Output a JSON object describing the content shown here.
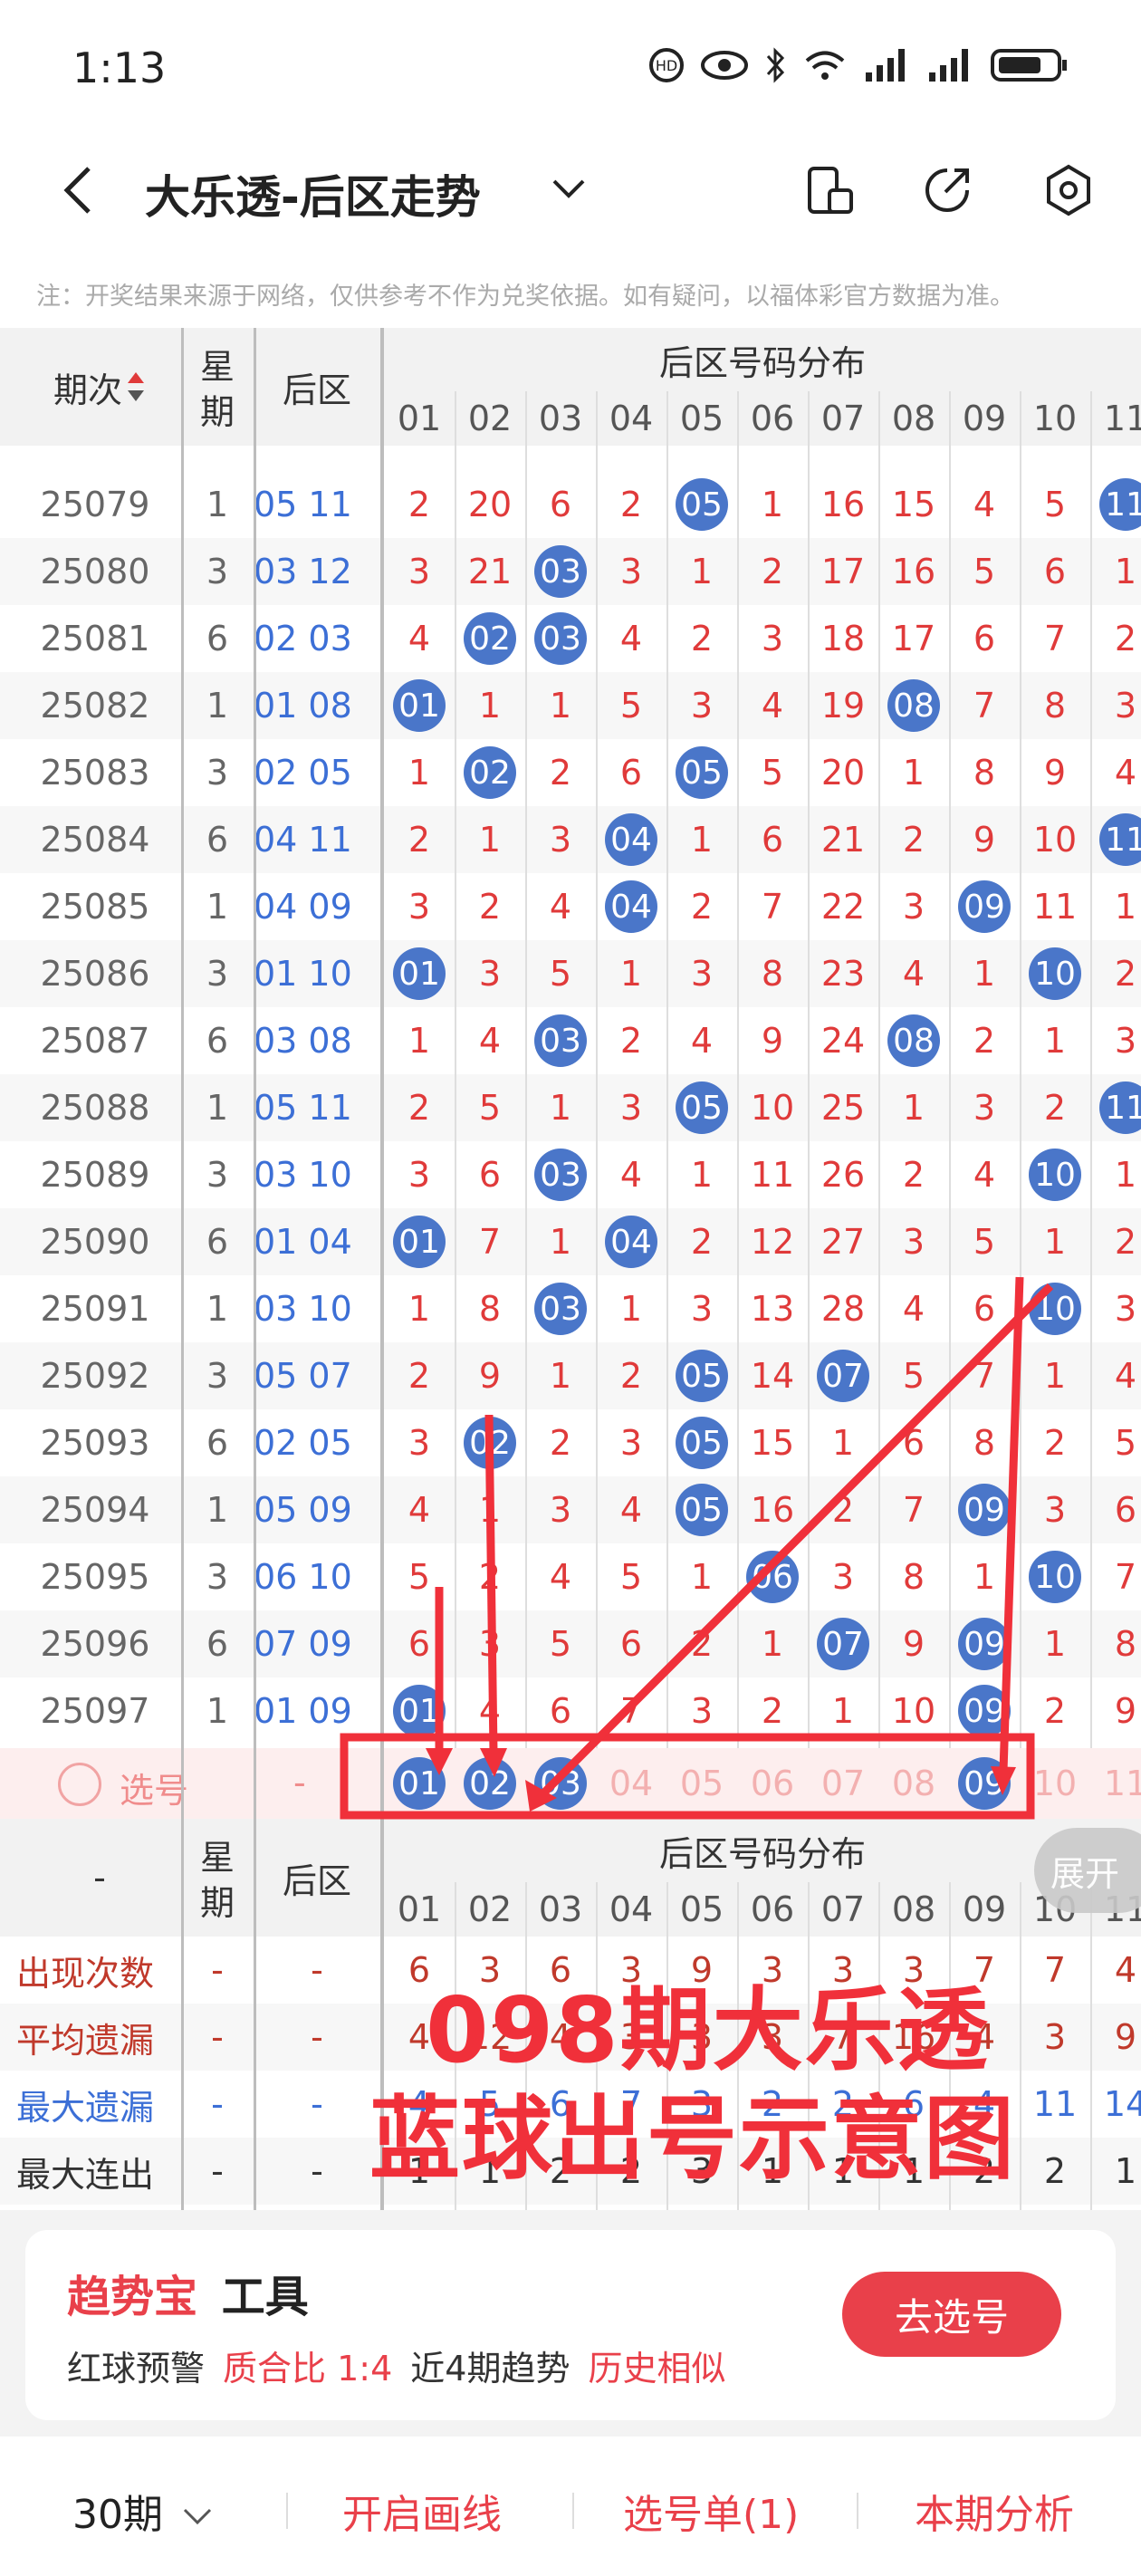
{
  "status": {
    "time": "1:13"
  },
  "header": {
    "title": "大乐透-后区走势"
  },
  "notice": "注：开奖结果来源于网络，仅供参考不作为兑奖依据。如有疑问，以福体彩官方数据为准。",
  "table_header": {
    "period": "期次",
    "weekday_line1": "星",
    "weekday_line2": "期",
    "back": "后区",
    "distribution": "后区号码分布",
    "numbers": [
      "01",
      "02",
      "03",
      "04",
      "05",
      "06",
      "07",
      "08",
      "09",
      "10",
      "11"
    ]
  },
  "rows": [
    {
      "period": "25079",
      "week": "1",
      "back": "05 11",
      "cells": [
        "2",
        "20",
        "6",
        "2",
        "05",
        "1",
        "16",
        "15",
        "4",
        "5",
        "11"
      ],
      "hits": [
        4,
        10
      ]
    },
    {
      "period": "25080",
      "week": "3",
      "back": "03 12",
      "cells": [
        "3",
        "21",
        "03",
        "3",
        "1",
        "2",
        "17",
        "16",
        "5",
        "6",
        "1"
      ],
      "hits": [
        2
      ]
    },
    {
      "period": "25081",
      "week": "6",
      "back": "02 03",
      "cells": [
        "4",
        "02",
        "03",
        "4",
        "2",
        "3",
        "18",
        "17",
        "6",
        "7",
        "2"
      ],
      "hits": [
        1,
        2
      ]
    },
    {
      "period": "25082",
      "week": "1",
      "back": "01 08",
      "cells": [
        "01",
        "1",
        "1",
        "5",
        "3",
        "4",
        "19",
        "08",
        "7",
        "8",
        "3"
      ],
      "hits": [
        0,
        7
      ]
    },
    {
      "period": "25083",
      "week": "3",
      "back": "02 05",
      "cells": [
        "1",
        "02",
        "2",
        "6",
        "05",
        "5",
        "20",
        "1",
        "8",
        "9",
        "4"
      ],
      "hits": [
        1,
        4
      ]
    },
    {
      "period": "25084",
      "week": "6",
      "back": "04 11",
      "cells": [
        "2",
        "1",
        "3",
        "04",
        "1",
        "6",
        "21",
        "2",
        "9",
        "10",
        "11"
      ],
      "hits": [
        3,
        10
      ]
    },
    {
      "period": "25085",
      "week": "1",
      "back": "04 09",
      "cells": [
        "3",
        "2",
        "4",
        "04",
        "2",
        "7",
        "22",
        "3",
        "09",
        "11",
        "1"
      ],
      "hits": [
        3,
        8
      ]
    },
    {
      "period": "25086",
      "week": "3",
      "back": "01 10",
      "cells": [
        "01",
        "3",
        "5",
        "1",
        "3",
        "8",
        "23",
        "4",
        "1",
        "10",
        "2"
      ],
      "hits": [
        0,
        9
      ]
    },
    {
      "period": "25087",
      "week": "6",
      "back": "03 08",
      "cells": [
        "1",
        "4",
        "03",
        "2",
        "4",
        "9",
        "24",
        "08",
        "2",
        "1",
        "3"
      ],
      "hits": [
        2,
        7
      ]
    },
    {
      "period": "25088",
      "week": "1",
      "back": "05 11",
      "cells": [
        "2",
        "5",
        "1",
        "3",
        "05",
        "10",
        "25",
        "1",
        "3",
        "2",
        "11"
      ],
      "hits": [
        4,
        10
      ]
    },
    {
      "period": "25089",
      "week": "3",
      "back": "03 10",
      "cells": [
        "3",
        "6",
        "03",
        "4",
        "1",
        "11",
        "26",
        "2",
        "4",
        "10",
        "1"
      ],
      "hits": [
        2,
        9
      ]
    },
    {
      "period": "25090",
      "week": "6",
      "back": "01 04",
      "cells": [
        "01",
        "7",
        "1",
        "04",
        "2",
        "12",
        "27",
        "3",
        "5",
        "1",
        "2"
      ],
      "hits": [
        0,
        3
      ]
    },
    {
      "period": "25091",
      "week": "1",
      "back": "03 10",
      "cells": [
        "1",
        "8",
        "03",
        "1",
        "3",
        "13",
        "28",
        "4",
        "6",
        "10",
        "3"
      ],
      "hits": [
        2,
        9
      ]
    },
    {
      "period": "25092",
      "week": "3",
      "back": "05 07",
      "cells": [
        "2",
        "9",
        "1",
        "2",
        "05",
        "14",
        "07",
        "5",
        "7",
        "1",
        "4"
      ],
      "hits": [
        4,
        6
      ]
    },
    {
      "period": "25093",
      "week": "6",
      "back": "02 05",
      "cells": [
        "3",
        "02",
        "2",
        "3",
        "05",
        "15",
        "1",
        "6",
        "8",
        "2",
        "5"
      ],
      "hits": [
        1,
        4
      ]
    },
    {
      "period": "25094",
      "week": "1",
      "back": "05 09",
      "cells": [
        "4",
        "1",
        "3",
        "4",
        "05",
        "16",
        "2",
        "7",
        "09",
        "3",
        "6"
      ],
      "hits": [
        4,
        8
      ]
    },
    {
      "period": "25095",
      "week": "3",
      "back": "06 10",
      "cells": [
        "5",
        "2",
        "4",
        "5",
        "1",
        "06",
        "3",
        "8",
        "1",
        "10",
        "7"
      ],
      "hits": [
        5,
        9
      ]
    },
    {
      "period": "25096",
      "week": "6",
      "back": "07 09",
      "cells": [
        "6",
        "3",
        "5",
        "6",
        "2",
        "1",
        "07",
        "9",
        "09",
        "1",
        "8"
      ],
      "hits": [
        6,
        8
      ]
    },
    {
      "period": "25097",
      "week": "1",
      "back": "01 09",
      "cells": [
        "01",
        "4",
        "6",
        "7",
        "3",
        "2",
        "1",
        "10",
        "09",
        "2",
        "9"
      ],
      "hits": [
        0,
        8
      ]
    }
  ],
  "select_row": {
    "label": "选号",
    "dash": "-",
    "cells": [
      "01",
      "02",
      "03",
      "04",
      "05",
      "06",
      "07",
      "08",
      "09",
      "10",
      "11"
    ],
    "selected": [
      0,
      1,
      2,
      8
    ]
  },
  "footer_header": {
    "dash": "-",
    "weekday_line1": "星",
    "weekday_line2": "期",
    "back": "后区",
    "distribution": "后区号码分布",
    "expand": "展开"
  },
  "stats": [
    {
      "label": "出现次数",
      "color": "#c0392b",
      "values": [
        "6",
        "3",
        "6",
        "3",
        "9",
        "3",
        "3",
        "3",
        "7",
        "7",
        "4"
      ]
    },
    {
      "label": "平均遗漏",
      "color": "#c0392b",
      "values": [
        "4",
        "12",
        "4",
        "3",
        "3",
        "3",
        "7",
        "16",
        "4",
        "3",
        "9"
      ]
    },
    {
      "label": "最大遗漏",
      "color": "#3c6fd6",
      "values": [
        "4",
        "5",
        "6",
        "7",
        "3",
        "2",
        "2",
        "6",
        "4",
        "11",
        "14"
      ]
    },
    {
      "label": "最大连出",
      "color": "#333333",
      "values": [
        "1",
        "1",
        "2",
        "2",
        "3",
        "1",
        "1",
        "1",
        "2",
        "2",
        "1"
      ]
    }
  ],
  "annotation": {
    "line1": "098期大乐透",
    "line2": "蓝球出号示意图"
  },
  "tools": {
    "brand": "趋势宝",
    "brand_suffix": "工具",
    "red_warning": "红球预警",
    "ratio": "质合比 1:4",
    "recent": "近4期趋势",
    "history": "历史相似",
    "go": "去选号"
  },
  "bottom": {
    "periods": "30期",
    "draw": "开启画线",
    "slip": "选号单(1)",
    "analysis": "本期分析"
  },
  "colors": {
    "accent": "#e9404a",
    "ball": "#4a76c9",
    "red_text": "#e03a3a",
    "blue_text": "#3c6fd6"
  }
}
